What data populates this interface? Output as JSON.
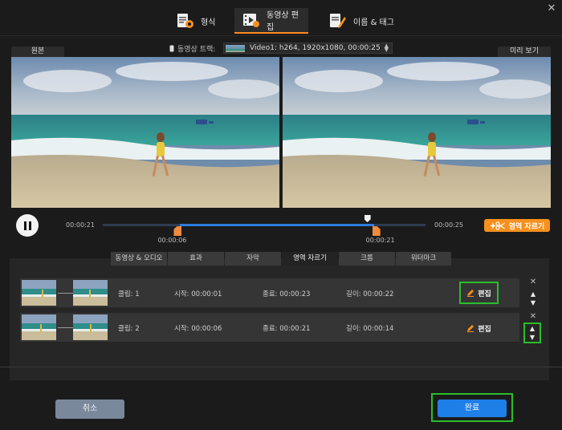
{
  "window": {
    "close_label": "✕"
  },
  "tabs": [
    {
      "label": "형식",
      "icon": "format-settings-icon",
      "active": false
    },
    {
      "label": "동영상 편집",
      "icon": "video-edit-icon",
      "active": true
    },
    {
      "label": "이름 & 태그",
      "icon": "rename-tag-icon",
      "active": false
    }
  ],
  "track": {
    "label": "동영상 트랙:",
    "value": "Video1: h264, 1920x1080, 00:00:25"
  },
  "panes": {
    "original_label": "원본",
    "preview_label": "미리 보기"
  },
  "playback": {
    "current_time": "00:00:21",
    "total_time": "00:00:25",
    "start_marker": "00:00:06",
    "end_marker": "00:00:21",
    "selection_start_fraction": 0.24,
    "selection_end_fraction": 0.84,
    "playhead_fraction": 0.82
  },
  "crop_button": {
    "label": "영역 자르기",
    "icon": "add-scissors-icon"
  },
  "edit_tabs": [
    {
      "label": "동영상 & 오디오",
      "active": false
    },
    {
      "label": "효과",
      "active": false
    },
    {
      "label": "자막",
      "active": false
    },
    {
      "label": "영역 자르기",
      "active": true
    },
    {
      "label": "크롭",
      "active": false
    },
    {
      "label": "워터마크",
      "active": false
    }
  ],
  "clips": [
    {
      "clip": "클립: 1",
      "start": "시작: 00:00:01",
      "end": "종료: 00:00:23",
      "length": "길이: 00:00:22",
      "edit_label": "편집"
    },
    {
      "clip": "클립: 2",
      "start": "시작: 00:00:06",
      "end": "종료: 00:00:21",
      "length": "길이: 00:00:14",
      "edit_label": "편집"
    }
  ],
  "footer": {
    "cancel_label": "취소",
    "done_label": "완료"
  },
  "colors": {
    "accent": "#ff8a1e",
    "primary": "#1f7fe8",
    "highlight": "#2bbd2b",
    "timeline": "#2f7bdc"
  }
}
